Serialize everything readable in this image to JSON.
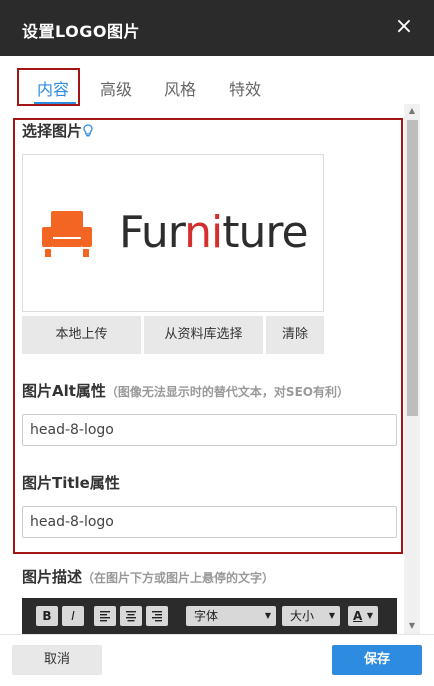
{
  "dialog": {
    "title": "设置LOGO图片",
    "close_icon": "×"
  },
  "tabs": [
    {
      "label": "内容",
      "active": true
    },
    {
      "label": "高级",
      "active": false
    },
    {
      "label": "风格",
      "active": false
    },
    {
      "label": "特效",
      "active": false
    }
  ],
  "image_section": {
    "label": "选择图片",
    "hint_icon": "lightbulb-icon",
    "preview": {
      "logo_icon": "armchair-icon",
      "brand_prefix": "Fur",
      "brand_highlight": "ni",
      "brand_suffix": "ture",
      "brand_color": "#2d2d2d",
      "highlight_color": "#d32f2f",
      "icon_color": "#f26522"
    },
    "buttons": [
      "本地上传",
      "从资料库选择",
      "清除"
    ]
  },
  "alt_field": {
    "label": "图片Alt属性",
    "hint": "（图像无法显示时的替代文本，对SEO有利）",
    "value": "head-8-logo"
  },
  "title_field": {
    "label": "图片Title属性",
    "value": "head-8-logo"
  },
  "description": {
    "label": "图片描述",
    "hint": "（在图片下方或图片上悬停的文字）",
    "toolbar": {
      "bold": "B",
      "italic": "I",
      "font_select": "字体",
      "size_select": "大小",
      "color_button": "A"
    }
  },
  "footer": {
    "cancel": "取消",
    "save": "保存"
  },
  "colors": {
    "accent": "#2d8cdf",
    "highlight_border": "#a41616",
    "titlebar": "#2b2b2b"
  }
}
